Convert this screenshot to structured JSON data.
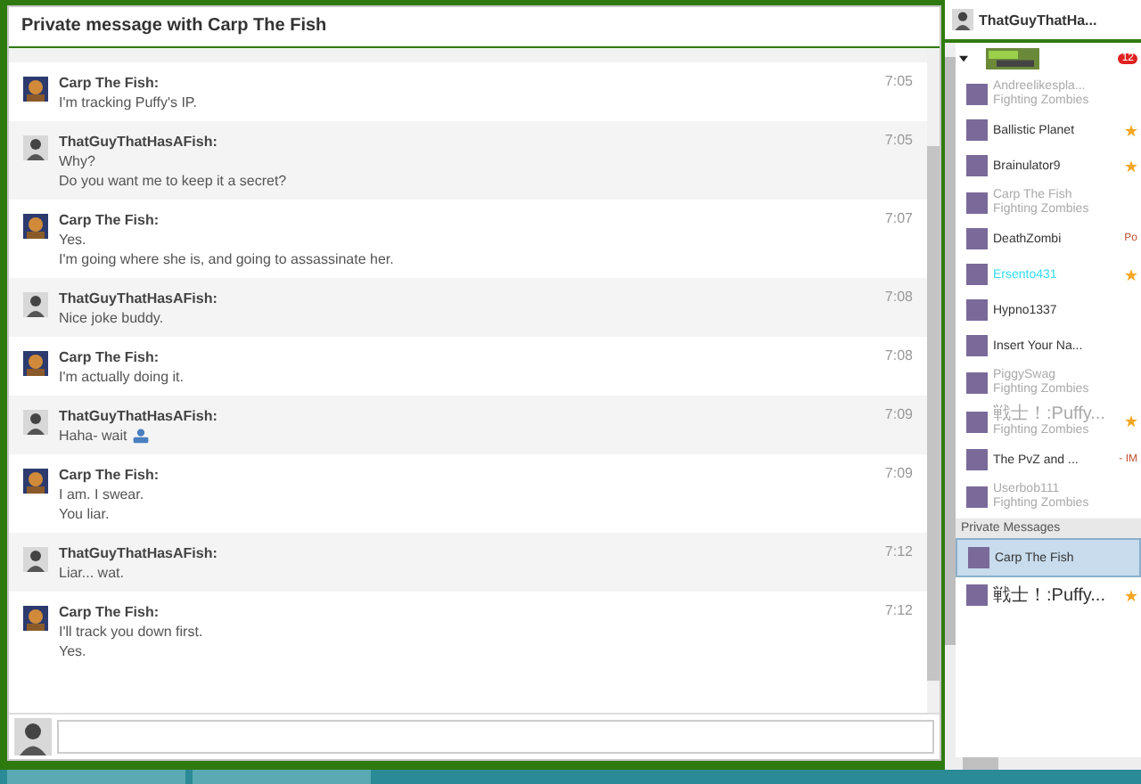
{
  "chat": {
    "title": "Private message with Carp The Fish",
    "messages": [
      {
        "sender": "Carp The Fish:",
        "kind": "fish",
        "lines": [
          "I'm tracking Puffy's IP."
        ],
        "time": "7:05",
        "emoticon": false
      },
      {
        "sender": "ThatGuyThatHasAFish:",
        "kind": "guy",
        "lines": [
          "Why?",
          "Do you want me to keep it a secret?"
        ],
        "time": "7:05",
        "emoticon": false
      },
      {
        "sender": "Carp The Fish:",
        "kind": "fish",
        "lines": [
          "Yes.",
          "I'm going where she is, and going to assassinate her."
        ],
        "time": "7:07",
        "emoticon": false
      },
      {
        "sender": "ThatGuyThatHasAFish:",
        "kind": "guy",
        "lines": [
          "Nice joke buddy."
        ],
        "time": "7:08",
        "emoticon": false
      },
      {
        "sender": "Carp The Fish:",
        "kind": "fish",
        "lines": [
          "I'm actually doing it."
        ],
        "time": "7:08",
        "emoticon": false
      },
      {
        "sender": "ThatGuyThatHasAFish:",
        "kind": "guy",
        "lines": [
          "Haha- wait"
        ],
        "time": "7:09",
        "emoticon": true
      },
      {
        "sender": "Carp The Fish:",
        "kind": "fish",
        "lines": [
          "I am. I swear.",
          "You liar."
        ],
        "time": "7:09",
        "emoticon": false
      },
      {
        "sender": "ThatGuyThatHasAFish:",
        "kind": "guy",
        "lines": [
          "Liar... wat."
        ],
        "time": "7:12",
        "emoticon": false
      },
      {
        "sender": "Carp The Fish:",
        "kind": "fish",
        "lines": [
          "I'll track you down first.",
          "Yes."
        ],
        "time": "7:12",
        "emoticon": false
      }
    ],
    "input": {
      "kind": "guy"
    }
  },
  "sidebar": {
    "user": "ThatGuyThatHa...",
    "badge": "12",
    "users": [
      {
        "name": "Andreelikespla...",
        "subtitle": "Fighting Zombies",
        "offline": true,
        "star": false
      },
      {
        "name": "Ballistic Planet",
        "offline": false,
        "star": true
      },
      {
        "name": "Brainulator9",
        "offline": false,
        "star": true
      },
      {
        "name": "Carp The Fish",
        "subtitle": "Fighting Zombies",
        "offline": true,
        "star": false
      },
      {
        "name": "DeathZombi",
        "offline": false,
        "star": false,
        "tag": "Po"
      },
      {
        "name": "Ersento431",
        "offline": false,
        "star": true,
        "color": "#33dcef"
      },
      {
        "name": "Hypno1337",
        "offline": false,
        "star": false
      },
      {
        "name": "Insert Your Na...",
        "offline": false,
        "star": false
      },
      {
        "name": "PiggySwag",
        "subtitle": "Fighting Zombies",
        "offline": true,
        "star": false
      },
      {
        "name": "戦士！:Puffy...",
        "subtitle": "Fighting Zombies",
        "offline": true,
        "star": true
      },
      {
        "name": "The PvZ and ...",
        "offline": false,
        "star": false,
        "tag": "- IM"
      },
      {
        "name": "Userbob111",
        "subtitle": "Fighting Zombies",
        "offline": true,
        "star": false
      }
    ],
    "pm_heading": "Private Messages",
    "conversations": [
      {
        "name": "Carp The Fish",
        "selected": true,
        "star": false
      },
      {
        "name": "戦士！:Puffy...",
        "selected": false,
        "star": true
      }
    ]
  }
}
